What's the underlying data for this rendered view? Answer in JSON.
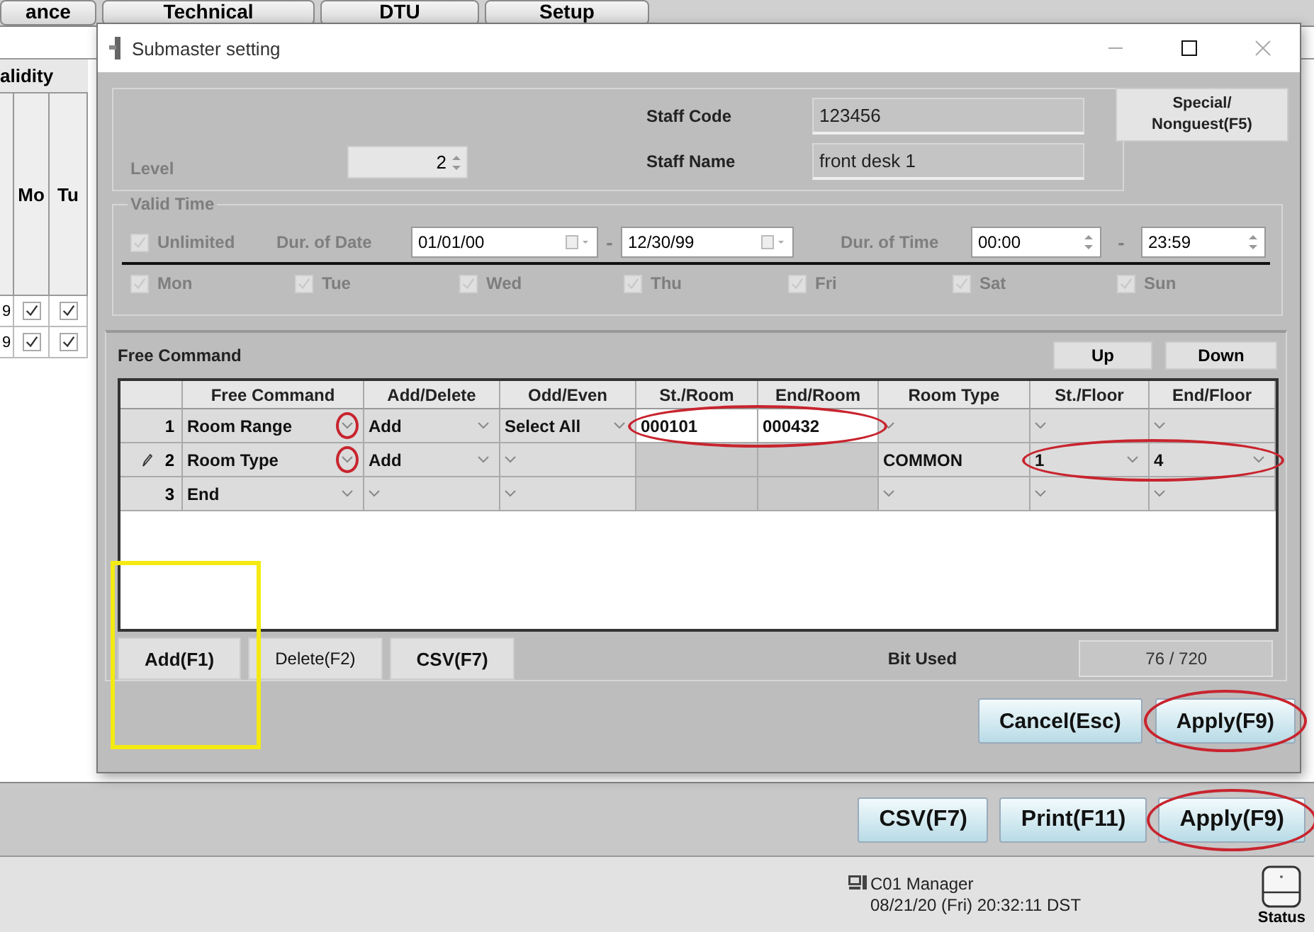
{
  "app": {
    "tabs": [
      {
        "label": "ance",
        "selected": false
      },
      {
        "label": "Technical",
        "selected": false
      },
      {
        "label": "DTU",
        "selected": false
      },
      {
        "label": "Setup",
        "selected": false
      }
    ],
    "table": {
      "title": "alidity",
      "columns": [
        "Mo",
        "Tu"
      ],
      "rows": [
        {
          "lead": "9",
          "checks": [
            true,
            true
          ]
        },
        {
          "lead": "9",
          "checks": [
            true,
            true
          ]
        }
      ]
    },
    "buttons": [
      {
        "label": "CSV(F7)",
        "circled": false
      },
      {
        "label": "Print(F11)",
        "circled": false
      },
      {
        "label": "Apply(F9)",
        "circled": true
      }
    ],
    "status": {
      "terminal": "C01 Manager",
      "datetime": "08/21/20 (Fri) 20:32:11 DST",
      "label": "Status"
    }
  },
  "dialog": {
    "title": "Submaster setting",
    "level": {
      "label": "Level",
      "value": "2",
      "disabled": true
    },
    "staff_code": {
      "label": "Staff Code",
      "value": "123456"
    },
    "staff_name": {
      "label": "Staff Name",
      "value": "front desk 1"
    },
    "special_button": "Special/\nNonguest(F5)",
    "valid_time": {
      "legend": "Valid Time",
      "disabled": true,
      "unlimited": {
        "label": "Unlimited",
        "checked": true
      },
      "date_label": "Dur. of Date",
      "date_from": "01/01/00",
      "date_separator": "-",
      "date_to": "12/30/99",
      "time_label": "Dur. of Time",
      "time_from": "00:00",
      "time_separator": "-",
      "time_to": "23:59",
      "days": [
        {
          "label": "Mon",
          "checked": true
        },
        {
          "label": "Tue",
          "checked": true
        },
        {
          "label": "Wed",
          "checked": true
        },
        {
          "label": "Thu",
          "checked": true
        },
        {
          "label": "Fri",
          "checked": true
        },
        {
          "label": "Sat",
          "checked": true
        },
        {
          "label": "Sun",
          "checked": true
        }
      ]
    },
    "free_command": {
      "title": "Free Command",
      "up": "Up",
      "down": "Down",
      "columns": [
        "Free Command",
        "Add/Delete",
        "Odd/Even",
        "St./Room",
        "End/Room",
        "Room Type",
        "St./Floor",
        "End/Floor"
      ],
      "rows": [
        {
          "number": "1",
          "editing": false,
          "cells": [
            {
              "kind": "combo",
              "value": "Room Range",
              "arrow_ringed": true
            },
            {
              "kind": "combo",
              "value": "Add"
            },
            {
              "kind": "combo",
              "value": "Select All"
            },
            {
              "kind": "input",
              "value": "000101",
              "ringed": true
            },
            {
              "kind": "input",
              "value": "000432",
              "ringed": true
            },
            {
              "kind": "combo"
            },
            {
              "kind": "combo"
            },
            {
              "kind": "combo"
            }
          ]
        },
        {
          "number": "2",
          "editing": true,
          "cells": [
            {
              "kind": "combo",
              "value": "Room Type",
              "arrow_ringed": true
            },
            {
              "kind": "combo",
              "value": "Add"
            },
            {
              "kind": "combo"
            },
            {
              "kind": "blank"
            },
            {
              "kind": "blank"
            },
            {
              "kind": "plain",
              "value": "COMMON"
            },
            {
              "kind": "combo",
              "value": "1",
              "ringed": true
            },
            {
              "kind": "combo",
              "value": "4",
              "ringed": true
            }
          ]
        },
        {
          "number": "3",
          "editing": false,
          "cells": [
            {
              "kind": "combo",
              "value": "End"
            },
            {
              "kind": "combo"
            },
            {
              "kind": "combo"
            },
            {
              "kind": "blank"
            },
            {
              "kind": "blank"
            },
            {
              "kind": "combo"
            },
            {
              "kind": "combo"
            },
            {
              "kind": "combo"
            }
          ]
        }
      ],
      "actions": [
        {
          "label": "Add(F1)",
          "boxed": true,
          "bold": true
        },
        {
          "label": "Delete(F2)",
          "boxed": false,
          "bold": false
        },
        {
          "label": "CSV(F7)",
          "boxed": false,
          "bold": true
        }
      ],
      "bit_used": {
        "label": "Bit Used",
        "value": "76 / 720"
      }
    },
    "footer_buttons": [
      {
        "label": "Cancel(Esc)",
        "circled": false
      },
      {
        "label": "Apply(F9)",
        "circled": true
      }
    ]
  }
}
